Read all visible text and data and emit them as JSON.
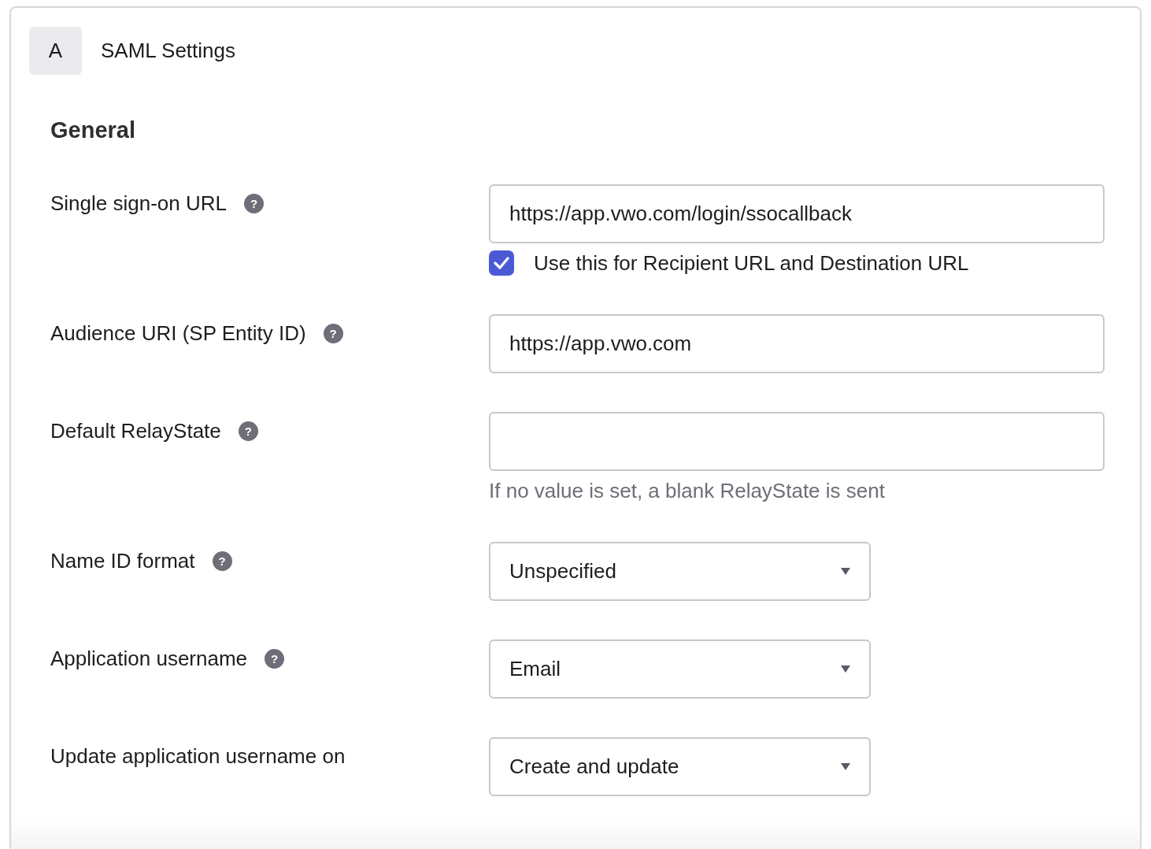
{
  "header": {
    "badge": "A",
    "title": "SAML Settings"
  },
  "section_title": "General",
  "fields": [
    {
      "kind": "text",
      "label": "Single sign-on URL",
      "help": "?",
      "value": "https://app.vwo.com/login/ssocallback",
      "checkbox": {
        "label": "Use this for Recipient URL and Destination URL",
        "checked": true
      }
    },
    {
      "kind": "text",
      "label": "Audience URI (SP Entity ID)",
      "help": "?",
      "value": "https://app.vwo.com"
    },
    {
      "kind": "text",
      "label": "Default RelayState",
      "help": "?",
      "hint": "If no value is set, a blank RelayState is sent"
    },
    {
      "kind": "select",
      "label": "Name ID format",
      "help": "?",
      "value": "Unspecified"
    },
    {
      "kind": "select",
      "label": "Application username",
      "help": "?",
      "value": "Email"
    },
    {
      "kind": "select",
      "label": "Update application username on",
      "value": "Create and update"
    }
  ]
}
